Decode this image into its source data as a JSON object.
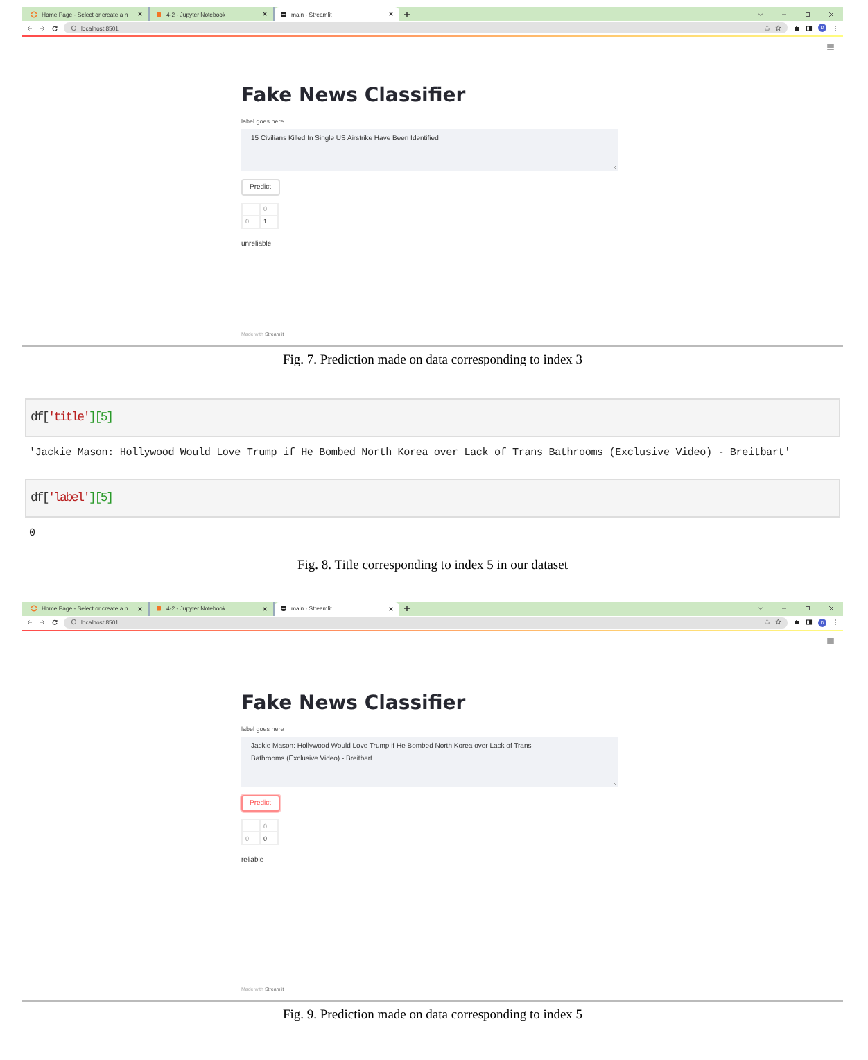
{
  "figures": [
    {
      "kind": "browser",
      "tabs": [
        {
          "title": "Home Page - Select or create a n",
          "kind": "jupyter",
          "selected": false
        },
        {
          "title": "4-2 - Jupyter Notebook",
          "kind": "notebook",
          "selected": false
        },
        {
          "title": "main · Streamlit",
          "kind": "streamlit",
          "selected": true
        }
      ],
      "address": "localhost:8501",
      "profile": "D",
      "app": {
        "title": "Fake News Classifier",
        "field_label": "label goes here",
        "text_value": "15 Civilians Killed In Single US Airstrike Have Been Identified",
        "button": "Predict",
        "button_focused": false,
        "table": {
          "header": [
            "0"
          ],
          "rows": [
            [
              "0",
              "1"
            ]
          ]
        },
        "result": "unreliable",
        "footer_prefix": "Made with",
        "footer_brand": "Streamlit"
      },
      "caption": "Fig. 7. Prediction made on data corresponding to index 3"
    },
    {
      "kind": "notebook",
      "cells": [
        {
          "code": [
            {
              "text": "df[",
              "kind": "plain"
            },
            {
              "text": "'title'",
              "kind": "string"
            },
            {
              "text": "][5]",
              "kind": "number"
            }
          ],
          "output": "'Jackie Mason: Hollywood Would Love Trump if He Bombed North Korea over Lack of Trans Bathrooms (Exclusive Video) - Breitbart'"
        },
        {
          "code": [
            {
              "text": "df[",
              "kind": "plain"
            },
            {
              "text": "'label'",
              "kind": "string"
            },
            {
              "text": "][5]",
              "kind": "number"
            }
          ],
          "output": "0"
        }
      ],
      "caption": "Fig. 8. Title corresponding to index 5 in our dataset"
    },
    {
      "kind": "browser",
      "tabs": [
        {
          "title": "Home Page - Select or create a n",
          "kind": "jupyter",
          "selected": false
        },
        {
          "title": "4-2 - Jupyter Notebook",
          "kind": "notebook",
          "selected": false
        },
        {
          "title": "main · Streamlit",
          "kind": "streamlit",
          "selected": true
        }
      ],
      "address": "localhost:8501",
      "profile": "D",
      "app": {
        "title": "Fake News Classifier",
        "field_label": "label goes here",
        "text_value": "Jackie Mason: Hollywood Would Love Trump if He Bombed North Korea over Lack of Trans Bathrooms (Exclusive Video) - Breitbart",
        "button": "Predict",
        "button_focused": true,
        "table": {
          "header": [
            "0"
          ],
          "rows": [
            [
              "0",
              "0"
            ]
          ]
        },
        "result": "reliable",
        "footer_prefix": "Made with",
        "footer_brand": "Streamlit"
      },
      "caption": "Fig. 9. Prediction made on data corresponding to index 5"
    }
  ]
}
